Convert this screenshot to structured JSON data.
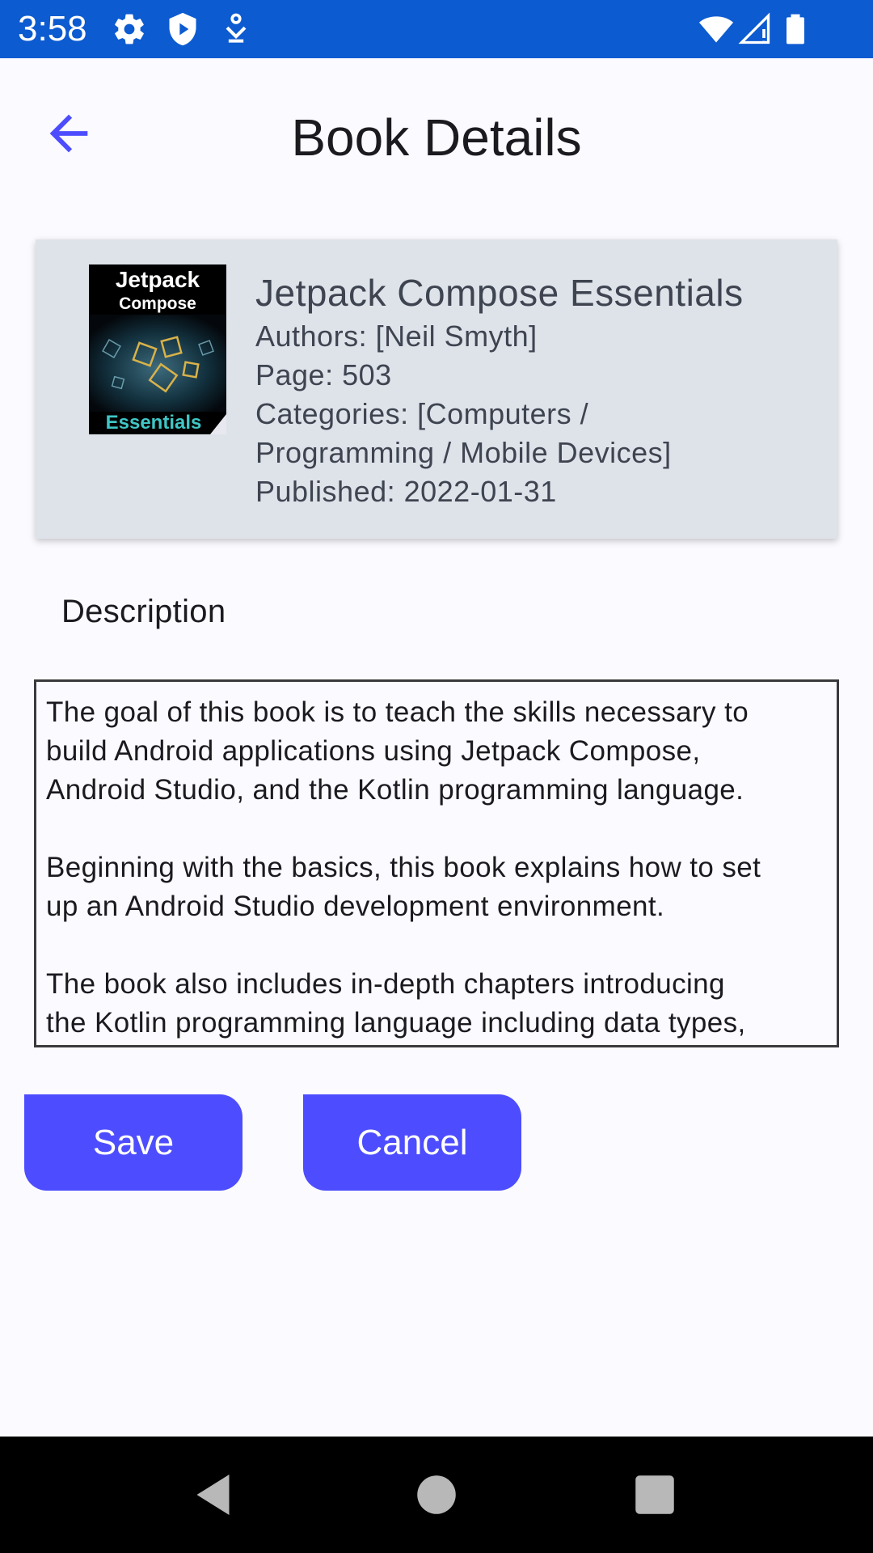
{
  "status_bar": {
    "time": "3:58",
    "icons": [
      "gear-icon",
      "play-protect-icon",
      "download-icon",
      "wifi-icon",
      "signal-icon",
      "battery-icon"
    ],
    "background": "#0C5BD0"
  },
  "header": {
    "title": "Book Details",
    "back_icon": "arrow-back-icon",
    "accent": "#4D4DFF"
  },
  "book": {
    "cover": {
      "line1": "Jetpack",
      "line2": "Compose",
      "line3": "Essentials"
    },
    "title": "Jetpack Compose Essentials",
    "authors": "Authors: [Neil Smyth]",
    "pages": "Page: 503",
    "categories_line1": "Categories: [Computers /",
    "categories_line2": "Programming / Mobile Devices]",
    "published": "Published: 2022-01-31"
  },
  "description": {
    "label": "Description",
    "text": "The goal of this book is to teach the skills necessary to\nbuild Android applications using Jetpack Compose,\nAndroid Studio, and the Kotlin programming language.\n\nBeginning with the basics, this book explains how to set\nup an Android Studio development environment.\n\nThe book also includes in-depth chapters introducing\nthe Kotlin programming language including data types,"
  },
  "actions": {
    "save_label": "Save",
    "cancel_label": "Cancel",
    "button_color": "#4D4DFF"
  },
  "nav_bar": {
    "icons": [
      "back-triangle-icon",
      "home-circle-icon",
      "recents-square-icon"
    ]
  }
}
